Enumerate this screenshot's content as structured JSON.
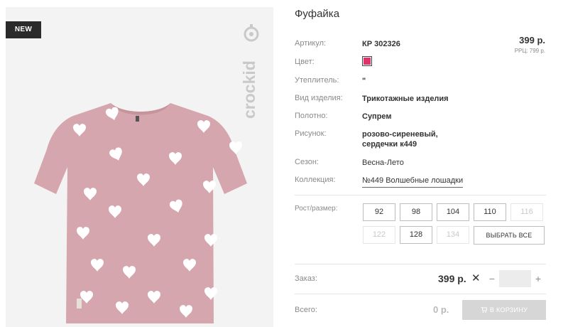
{
  "product": {
    "badge": "NEW",
    "brand": "crockid",
    "title": "Фуфайка"
  },
  "attributes": [
    {
      "label": "Артикул:",
      "value": "КР 302326"
    },
    {
      "label": "Цвет:",
      "value_color": "#e0336a"
    },
    {
      "label": "Утеплитель:",
      "value": "\""
    },
    {
      "label": "Вид изделия:",
      "value": "Трикотажные изделия"
    },
    {
      "label": "Полотно:",
      "value": "Супрем"
    },
    {
      "label": "Рисунок:",
      "value_line1": "розово-сиреневый,",
      "value_line2": "сердечки к449"
    },
    {
      "label": "Сезон:",
      "value": "Весна-Лето"
    },
    {
      "label": "Коллекция:",
      "value": "№449 Волшебные лошадки"
    }
  ],
  "price": {
    "value": "399 р.",
    "rrp": "РРЦ: 799 р."
  },
  "sizes": {
    "label": "Рост/размер:",
    "options": [
      {
        "label": "92",
        "available": true
      },
      {
        "label": "98",
        "available": true
      },
      {
        "label": "104",
        "available": true
      },
      {
        "label": "110",
        "available": true
      },
      {
        "label": "116",
        "available": false
      },
      {
        "label": "122",
        "available": false
      },
      {
        "label": "128",
        "available": true
      },
      {
        "label": "134",
        "available": false
      }
    ],
    "select_all": "ВЫБРАТЬ ВСЕ"
  },
  "order": {
    "label": "Заказ:",
    "price": "399 р.",
    "times": "✕",
    "minus": "−",
    "plus": "+",
    "quantity": ""
  },
  "total": {
    "label": "Всего:",
    "value": "0 р.",
    "cart_button": "В КОРЗИНУ"
  }
}
